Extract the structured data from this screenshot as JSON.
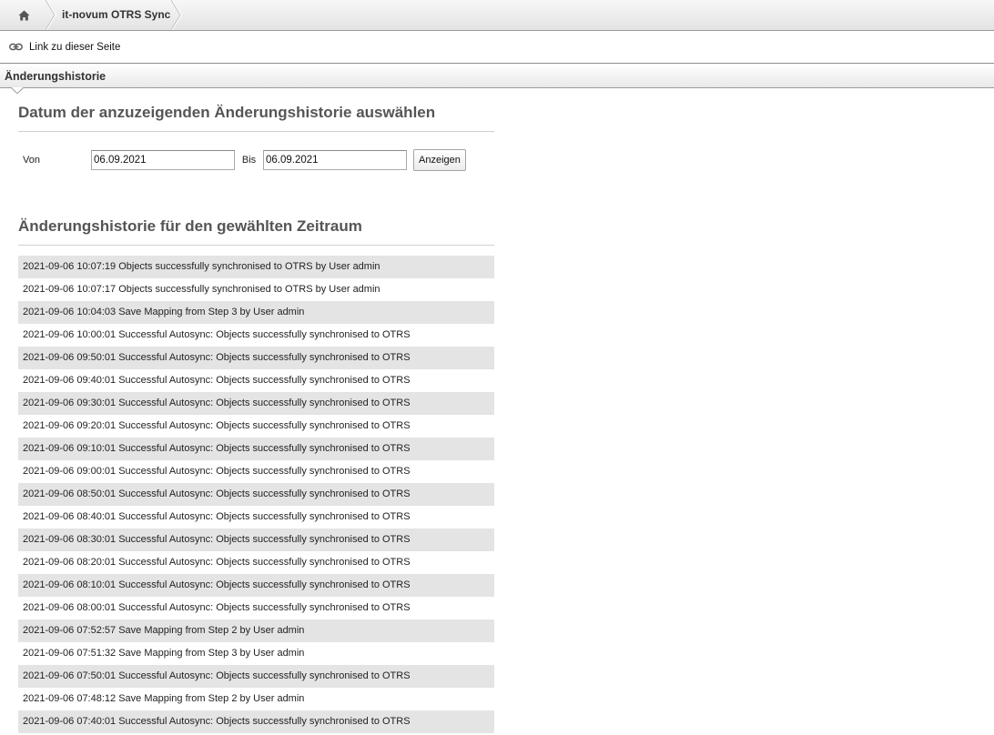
{
  "breadcrumb": {
    "home_icon": "home-icon",
    "current": "it-novum OTRS Sync"
  },
  "linkbar": {
    "icon": "link-icon",
    "label": "Link zu dieser Seite"
  },
  "section": {
    "title": "Änderungshistorie"
  },
  "date_select": {
    "heading": "Datum der anzuzeigenden Änderungshistorie auswählen",
    "from_label": "Von",
    "from_value": "06.09.2021",
    "to_label": "Bis",
    "to_value": "06.09.2021",
    "show_button": "Anzeigen"
  },
  "history": {
    "heading": "Änderungshistorie für den gewählten Zeitraum",
    "entries": [
      "2021-09-06 10:07:19 Objects successfully synchronised to OTRS by User admin",
      "2021-09-06 10:07:17 Objects successfully synchronised to OTRS by User admin",
      "2021-09-06 10:04:03 Save Mapping from Step 3 by User admin",
      "2021-09-06 10:00:01 Successful Autosync: Objects successfully synchronised to OTRS",
      "2021-09-06 09:50:01 Successful Autosync: Objects successfully synchronised to OTRS",
      "2021-09-06 09:40:01 Successful Autosync: Objects successfully synchronised to OTRS",
      "2021-09-06 09:30:01 Successful Autosync: Objects successfully synchronised to OTRS",
      "2021-09-06 09:20:01 Successful Autosync: Objects successfully synchronised to OTRS",
      "2021-09-06 09:10:01 Successful Autosync: Objects successfully synchronised to OTRS",
      "2021-09-06 09:00:01 Successful Autosync: Objects successfully synchronised to OTRS",
      "2021-09-06 08:50:01 Successful Autosync: Objects successfully synchronised to OTRS",
      "2021-09-06 08:40:01 Successful Autosync: Objects successfully synchronised to OTRS",
      "2021-09-06 08:30:01 Successful Autosync: Objects successfully synchronised to OTRS",
      "2021-09-06 08:20:01 Successful Autosync: Objects successfully synchronised to OTRS",
      "2021-09-06 08:10:01 Successful Autosync: Objects successfully synchronised to OTRS",
      "2021-09-06 08:00:01 Successful Autosync: Objects successfully synchronised to OTRS",
      "2021-09-06 07:52:57 Save Mapping from Step 2 by User admin",
      "2021-09-06 07:51:32 Save Mapping from Step 3 by User admin",
      "2021-09-06 07:50:01 Successful Autosync: Objects successfully synchronised to OTRS",
      "2021-09-06 07:48:12 Save Mapping from Step 2 by User admin",
      "2021-09-06 07:40:01 Successful Autosync: Objects successfully synchronised to OTRS"
    ]
  }
}
